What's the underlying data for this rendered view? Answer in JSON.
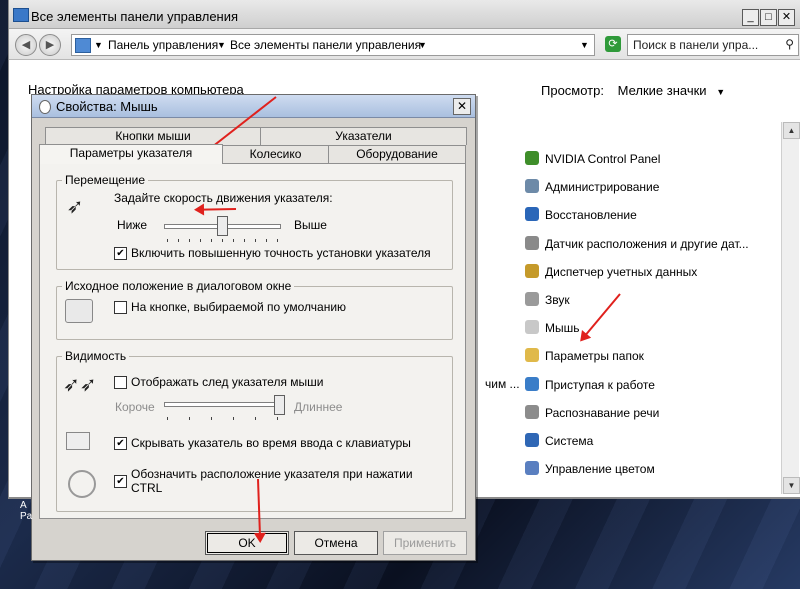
{
  "explorer": {
    "title": "Все элементы панели управления",
    "address": [
      "Панель управления",
      "Все элементы панели управления"
    ],
    "search_placeholder": "Поиск в панели упра...",
    "settings_title": "Настройка параметров компьютера",
    "view_label": "Просмотр:",
    "view_value": "Мелкие значки",
    "partial_text": "чим ...",
    "items": [
      {
        "label": "NVIDIA Control Panel",
        "icon": "nvidia-icon",
        "color": "#3f8e2a"
      },
      {
        "label": "Администрирование",
        "icon": "admin-tools-icon",
        "color": "#6d8aa8"
      },
      {
        "label": "Восстановление",
        "icon": "recovery-icon",
        "color": "#2a66b8"
      },
      {
        "label": "Датчик расположения и другие дат...",
        "icon": "location-sensor-icon",
        "color": "#8a8a8a"
      },
      {
        "label": "Диспетчер учетных данных",
        "icon": "credential-manager-icon",
        "color": "#c59a2a"
      },
      {
        "label": "Звук",
        "icon": "sound-icon",
        "color": "#9a9a9a"
      },
      {
        "label": "Мышь",
        "icon": "mouse-icon",
        "color": "#c8c8c8"
      },
      {
        "label": "Параметры папок",
        "icon": "folder-options-icon",
        "color": "#e0b94a"
      },
      {
        "label": "Приступая к работе",
        "icon": "getting-started-icon",
        "color": "#3a7dc8"
      },
      {
        "label": "Распознавание речи",
        "icon": "speech-recognition-icon",
        "color": "#8c8c8c"
      },
      {
        "label": "Система",
        "icon": "system-icon",
        "color": "#2f67b5"
      },
      {
        "label": "Управление цветом",
        "icon": "color-management-icon",
        "color": "#5a7fc0"
      }
    ]
  },
  "dialog": {
    "title": "Свойства: Мышь",
    "tabs_row1": [
      "Кнопки мыши",
      "Указатели"
    ],
    "tabs_row2": [
      "Параметры указателя",
      "Колесико",
      "Оборудование"
    ],
    "motion": {
      "group_label": "Перемещение",
      "prompt": "Задайте скорость движения указателя:",
      "slow": "Ниже",
      "fast": "Выше",
      "speed_fraction": 0.5,
      "precision_checked": true,
      "precision_label": "Включить повышенную точность установки указателя"
    },
    "snap": {
      "group_label": "Исходное положение в диалоговом окне",
      "checked": false,
      "label": "На кнопке, выбираемой по умолчанию"
    },
    "visibility": {
      "group_label": "Видимость",
      "trails_checked": false,
      "trails_label": "Отображать след указателя мыши",
      "trails_short": "Короче",
      "trails_long": "Длиннее",
      "trails_fraction": 1.0,
      "hide_checked": true,
      "hide_label": "Скрывать указатель во время ввода с клавиатуры",
      "ctrl_checked": true,
      "ctrl_label_line1": "Обозначить расположение указателя при нажатии",
      "ctrl_label_line2": "CTRL"
    },
    "buttons": {
      "ok": "OK",
      "cancel": "Отмена",
      "apply": "Применить"
    }
  },
  "desktop": {
    "partial_label": "A\nPa"
  },
  "colors": {
    "annotation_arrow": "#e0211d",
    "dialog_face": "#d6d3ce"
  }
}
